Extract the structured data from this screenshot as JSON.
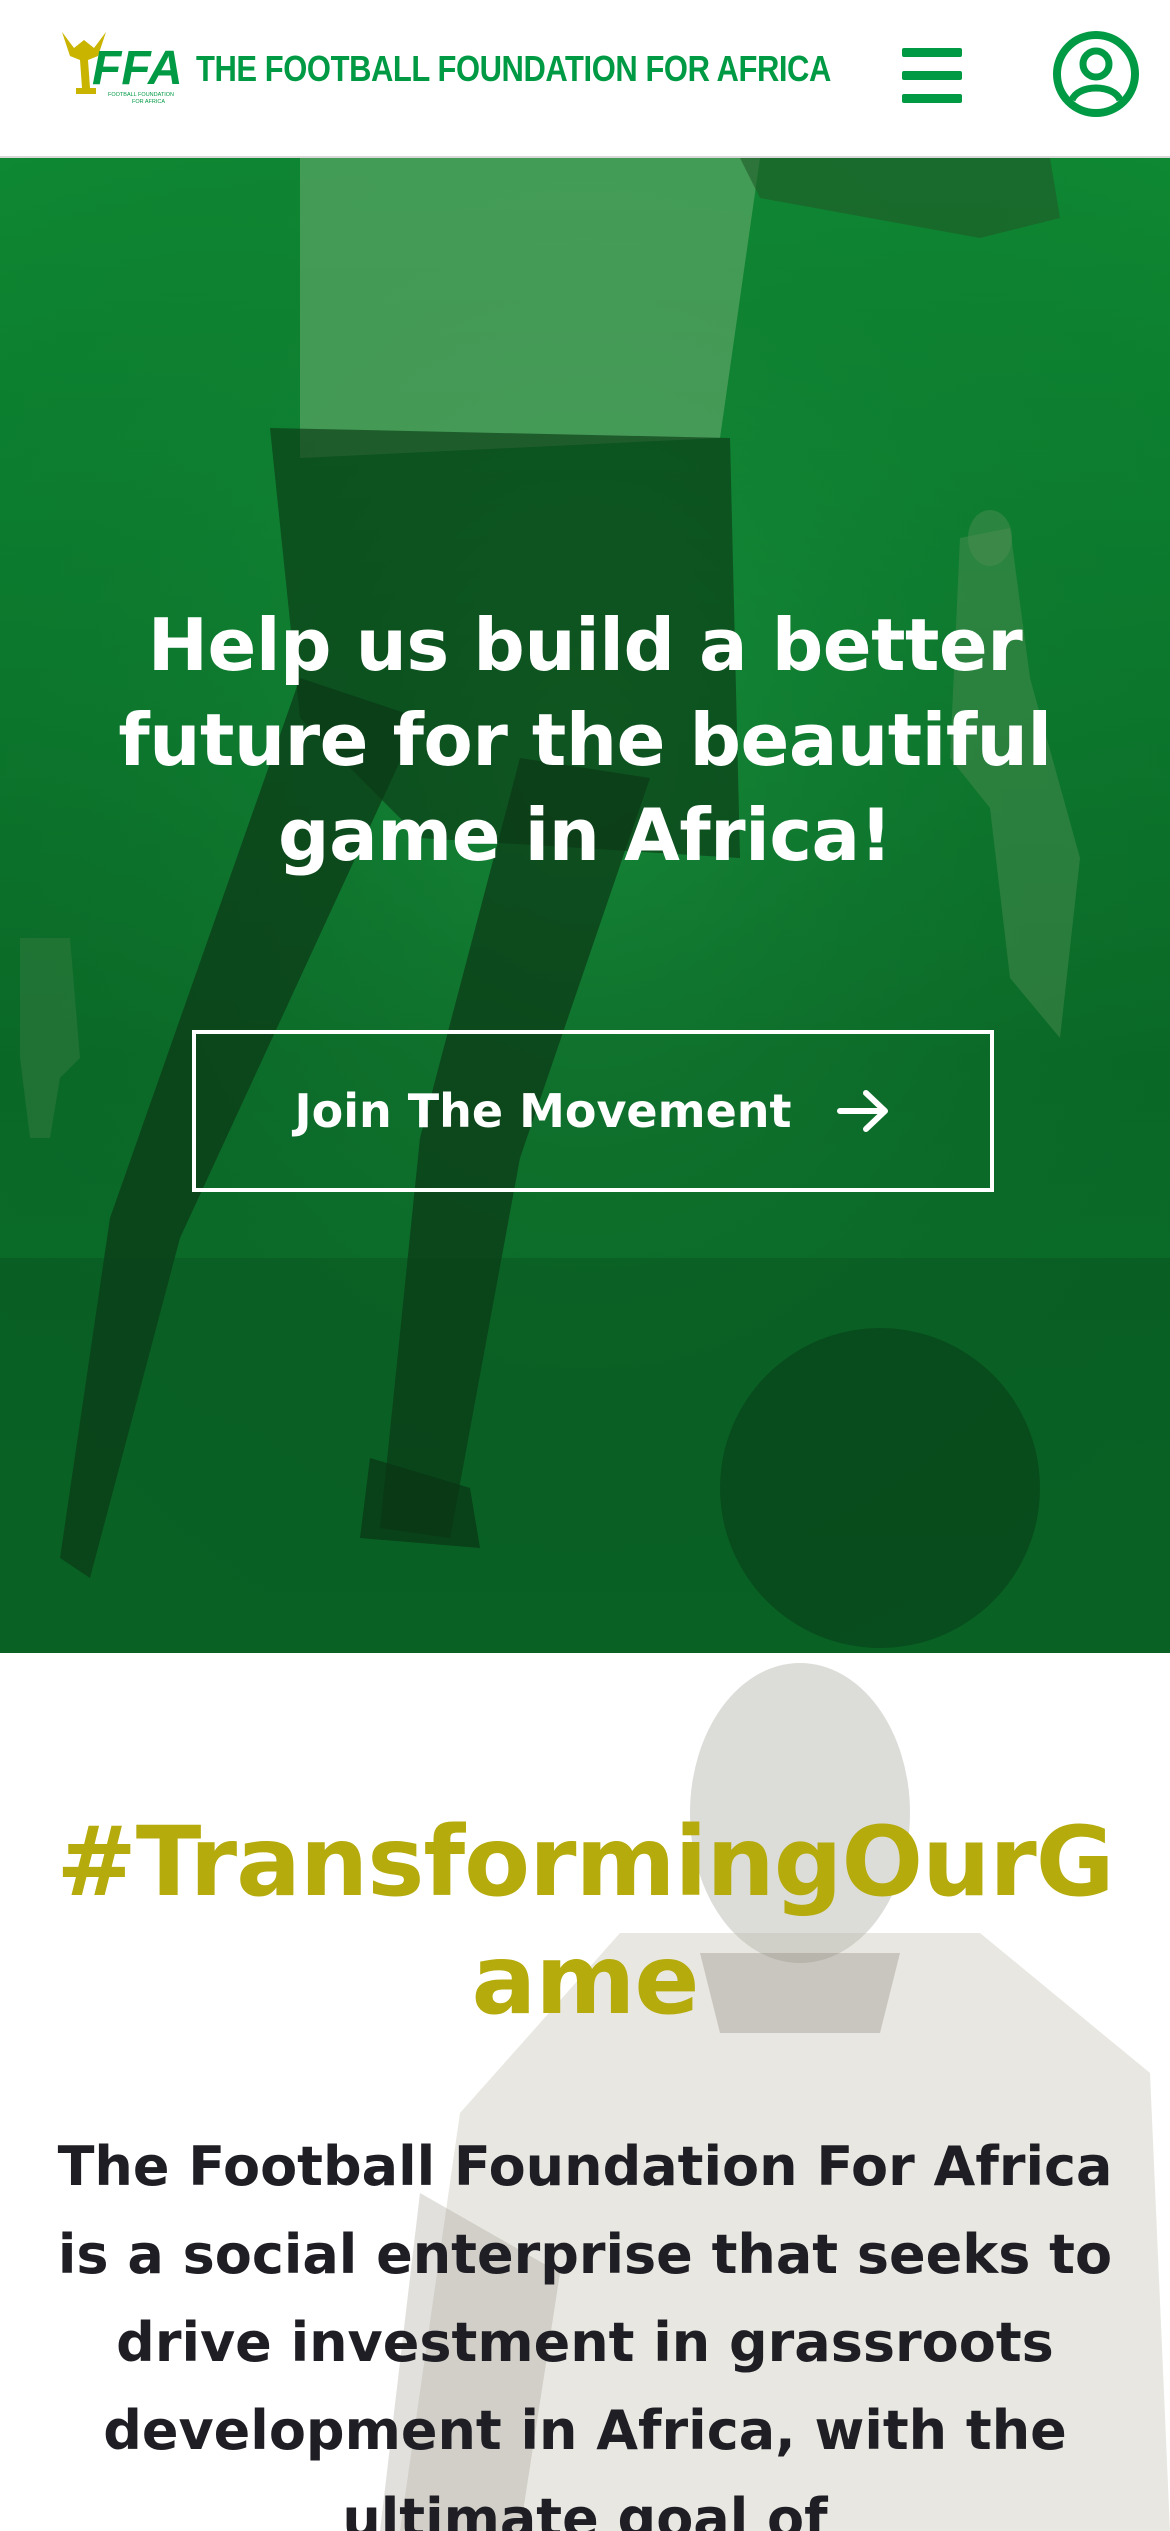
{
  "header": {
    "brand_name": "THE FOOTBALL FOUNDATION FOR AFRICA",
    "logo_text": "FFA",
    "logo_subtext": "FOOTBALL FOUNDATION FOR AFRICA",
    "menu_icon": "hamburger-menu-icon",
    "account_icon": "user-account-icon"
  },
  "hero": {
    "title": "Help us build a better future for the beautiful game in Africa!",
    "cta_label": "Join The Movement",
    "cta_icon": "arrow-right-icon"
  },
  "mission": {
    "hashtag": "#TransformingOurGame",
    "text": "The Football Foundation For Africa is a social enterprise that seeks to drive investment in grassroots development in Africa, with the ultimate goal of"
  },
  "colors": {
    "brand_green": "#009a44",
    "hero_green": "#0b7a2d",
    "hashtag_gold": "#b5ab0d",
    "text_dark": "#1e1e24"
  }
}
